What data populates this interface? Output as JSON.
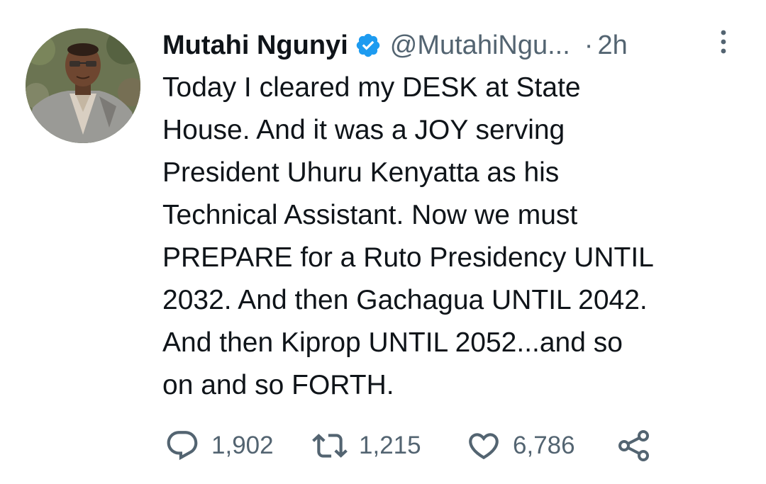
{
  "tweet": {
    "author": {
      "display_name": "Mutahi Ngunyi",
      "handle": "@MutahiNgu...",
      "verified": true,
      "avatar_icon": "profile-photo"
    },
    "separator": "·",
    "timestamp": "2h",
    "text_lines": [
      "Today I cleared my DESK at State",
      "House. And it was a JOY serving",
      "President Uhuru Kenyatta as his",
      "Technical Assistant. Now we must",
      "PREPARE for a Ruto Presidency UNTIL",
      "2032. And then Gachagua UNTIL 2042.",
      "And then Kiprop UNTIL 2052...and so",
      "on and so FORTH."
    ],
    "actions": {
      "reply": {
        "icon": "reply-icon",
        "count": "1,902"
      },
      "retweet": {
        "icon": "retweet-icon",
        "count": "1,215"
      },
      "like": {
        "icon": "heart-icon",
        "count": "6,786"
      },
      "share": {
        "icon": "share-icon"
      }
    }
  },
  "colors": {
    "text_primary": "#0f1419",
    "text_secondary": "#536471",
    "verified_blue": "#1d9bf0",
    "background": "#ffffff"
  }
}
